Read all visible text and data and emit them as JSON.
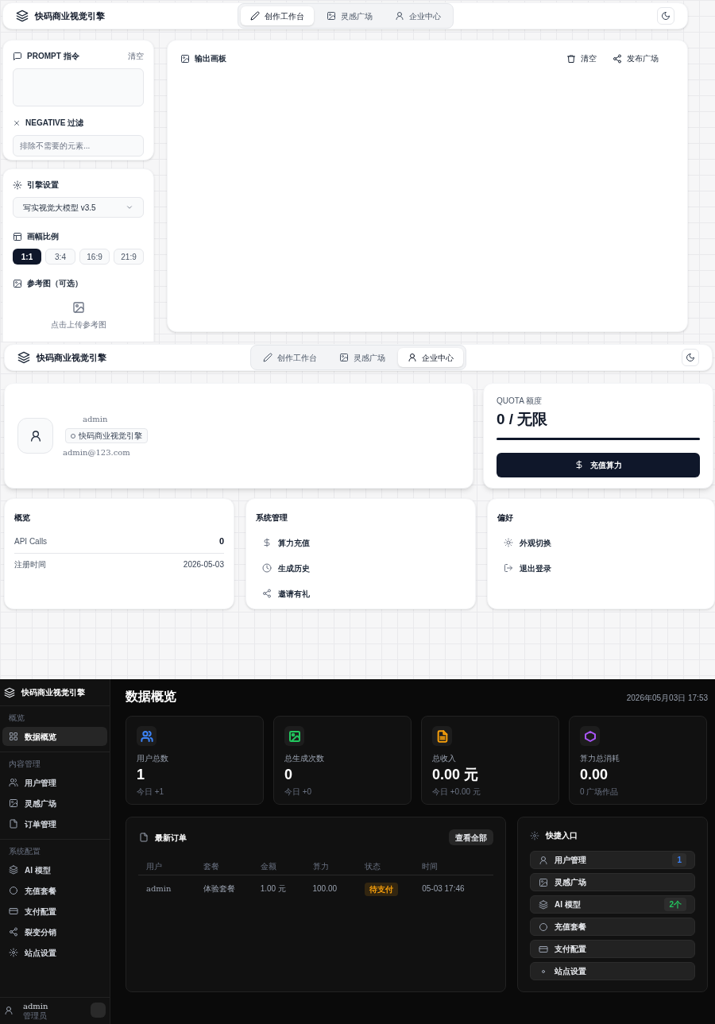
{
  "workspace": {
    "header": {
      "brand": "快码商业视觉引擎",
      "nav": [
        {
          "label": "创作工作台",
          "selected": true
        },
        {
          "label": "灵感广场",
          "selected": false
        },
        {
          "label": "企业中心",
          "selected": false
        }
      ]
    },
    "prompt_panel": {
      "title": "PROMPT 指令",
      "clear": "清空",
      "negative_title": "NEGATIVE 过滤",
      "negative_placeholder": "排除不需要的元素..."
    },
    "engine_panel": {
      "title": "引擎设置",
      "model": "写实视觉大模型 v3.5",
      "ratio_title": "画幅比例",
      "ratios": [
        {
          "label": "1:1",
          "selected": true
        },
        {
          "label": "3:4",
          "selected": false
        },
        {
          "label": "16:9",
          "selected": false
        },
        {
          "label": "21:9",
          "selected": false
        }
      ],
      "reference_title": "参考图（可选）",
      "upload_hint": "点击上传参考图"
    },
    "output_panel": {
      "title": "输出画板",
      "actions": [
        "清空",
        "发布广场"
      ]
    }
  },
  "enterprise": {
    "header": {
      "brand": "快码商业视觉引擎",
      "nav": [
        {
          "label": "创作工作台",
          "selected": false
        },
        {
          "label": "灵感广场",
          "selected": false
        },
        {
          "label": "企业中心",
          "selected": true
        }
      ]
    },
    "profile": {
      "name": "admin",
      "org_tag": "快码商业视觉引擎",
      "email": "admin@123.com"
    },
    "quota": {
      "label": "QUOTA 额度",
      "value": "0 / 无限",
      "level": 1,
      "button": "充值算力"
    },
    "overview": {
      "title": "概览",
      "rows": [
        {
          "label": "API Calls",
          "value": "0"
        },
        {
          "label": "注册时间",
          "value": "2026-05-03"
        }
      ]
    },
    "system": {
      "title": "系统管理",
      "items": [
        "算力充值",
        "生成历史",
        "邀请有礼"
      ]
    },
    "preferences": {
      "title": "偏好",
      "items": [
        "外观切换",
        "退出登录"
      ]
    }
  },
  "admin": {
    "sidebar": {
      "brand": "快码商业视觉引擎",
      "groups": [
        {
          "title": "概览",
          "items": [
            {
              "label": "数据概览",
              "selected": true
            }
          ]
        },
        {
          "title": "内容管理",
          "items": [
            {
              "label": "用户管理",
              "selected": false
            },
            {
              "label": "灵感广场",
              "selected": false
            },
            {
              "label": "订单管理",
              "selected": false
            }
          ]
        },
        {
          "title": "系统配置",
          "items": [
            {
              "label": "AI 模型",
              "selected": false
            },
            {
              "label": "充值套餐",
              "selected": false
            },
            {
              "label": "支付配置",
              "selected": false
            },
            {
              "label": "裂变分销",
              "selected": false
            },
            {
              "label": "站点设置",
              "selected": false
            }
          ]
        }
      ],
      "user": {
        "name": "admin",
        "role": "管理员"
      }
    },
    "title": "数据概览",
    "datetime": "2026年05月03日 17:53",
    "stats": [
      {
        "label": "用户总数",
        "value": "1",
        "sub": "今日 +1",
        "color": "#3b82f6"
      },
      {
        "label": "总生成次数",
        "value": "0",
        "sub": "今日 +0",
        "color": "#22c55e"
      },
      {
        "label": "总收入",
        "value": "0.00 元",
        "sub": "今日 +0.00 元",
        "color": "#f59e0b"
      },
      {
        "label": "算力总消耗",
        "value": "0.00",
        "sub": "0 广场作品",
        "color": "#a855f7"
      }
    ],
    "orders": {
      "title": "最新订单",
      "view_all": "查看全部",
      "columns": [
        "用户",
        "套餐",
        "金额",
        "算力",
        "状态",
        "时间"
      ],
      "rows": [
        {
          "user": "admin",
          "plan": "体验套餐",
          "amount": "1.00 元",
          "compute": "100.00",
          "status": "待支付",
          "time": "05-03 17:46"
        }
      ]
    },
    "shortcuts": {
      "title": "快捷入口",
      "items": [
        {
          "label": "用户管理",
          "badge": "1",
          "color": "#3b82f6"
        },
        {
          "label": "灵感广场"
        },
        {
          "label": "AI 模型",
          "badge": "2个",
          "color": "#22c55e"
        },
        {
          "label": "充值套餐"
        },
        {
          "label": "支付配置"
        },
        {
          "label": "站点设置"
        }
      ]
    }
  }
}
